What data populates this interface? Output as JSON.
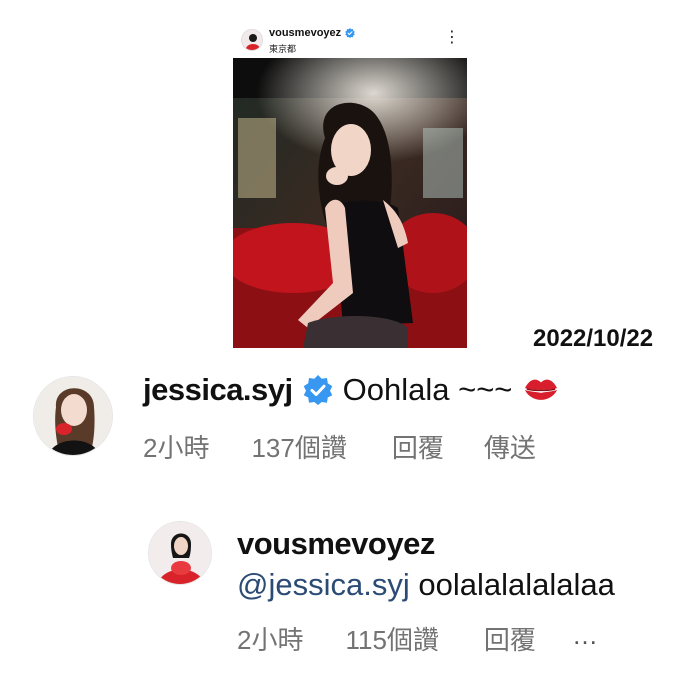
{
  "post": {
    "username": "vousmevoyez",
    "location": "東京都",
    "more_glyph": "⋮"
  },
  "date_stamp": "2022/10/22",
  "comment_1": {
    "username": "jessica.syj",
    "text": "Oohlala ~~~",
    "time": "2小時",
    "likes": "137個讚",
    "reply": "回覆",
    "send": "傳送"
  },
  "comment_2": {
    "username": "vousmevoyez",
    "mention": "@jessica.syj",
    "text": "oolalalalalalaa",
    "time": "2小時",
    "likes": "115個讚",
    "reply": "回覆",
    "more": "…"
  },
  "colors": {
    "meta_gray": "#737373",
    "mention_blue": "#2b4a74",
    "verified_blue": "#3897f0",
    "kiss_red": "#d81e2c"
  }
}
